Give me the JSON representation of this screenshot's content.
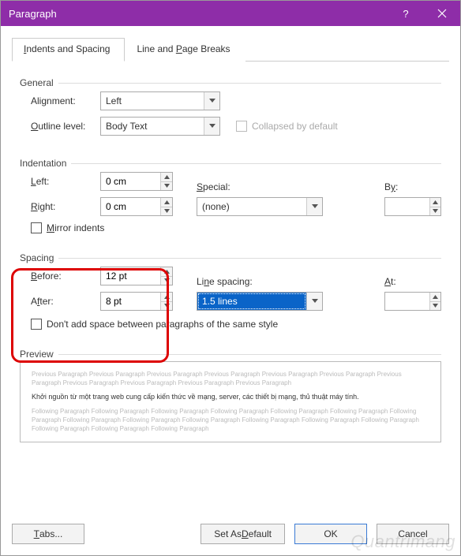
{
  "title": "Paragraph",
  "tabs": {
    "indents": "Indents and Spacing",
    "line": "Line and Page Breaks"
  },
  "general": {
    "legend": "General",
    "alignment_label_pre": "Ali",
    "alignment_label_u": "g",
    "alignment_label_post": "nment:",
    "alignment_value": "Left",
    "outline_label_u": "O",
    "outline_label_post": "utline level:",
    "outline_value": "Body Text",
    "collapsed": "Collapsed by default"
  },
  "indentation": {
    "legend": "Indentation",
    "left_u": "L",
    "left_post": "eft:",
    "left_value": "0 cm",
    "right_u": "R",
    "right_post": "ight:",
    "right_value": "0 cm",
    "special_u": "S",
    "special_post": "pecial:",
    "special_value": "(none)",
    "by_pre": "B",
    "by_u": "y",
    "by_post": ":",
    "mirror_u": "M",
    "mirror_post": "irror indents"
  },
  "spacing": {
    "legend": "Spacing",
    "before_u": "B",
    "before_post": "efore:",
    "before_value": "12 pt",
    "after_pre": "A",
    "after_u": "f",
    "after_post": "ter:",
    "after_value": "8 pt",
    "line_pre": "Li",
    "line_u": "n",
    "line_post": "e spacing:",
    "line_value": "1.5 lines",
    "at_u": "A",
    "at_post": "t:",
    "no_space": "Don't add space between paragraphs of the same style"
  },
  "preview": {
    "legend": "Preview",
    "prev": "Previous Paragraph Previous Paragraph Previous Paragraph Previous Paragraph Previous Paragraph Previous Paragraph Previous Paragraph Previous Paragraph Previous Paragraph Previous Paragraph Previous Paragraph",
    "sample": "Khởi nguồn từ một trang web cung cấp kiến thức về mạng, server, các thiết bị mạng, thủ thuật máy tính.",
    "next": "Following Paragraph Following Paragraph Following Paragraph Following Paragraph Following Paragraph Following Paragraph Following Paragraph Following Paragraph Following Paragraph Following Paragraph Following Paragraph Following Paragraph Following Paragraph Following Paragraph Following Paragraph Following Paragraph"
  },
  "footer": {
    "tabs": "Tabs...",
    "default": "Set As Default",
    "ok": "OK",
    "cancel": "Cancel",
    "tabs_u": "T",
    "default_u": "D"
  },
  "watermark": "Quantrimang"
}
